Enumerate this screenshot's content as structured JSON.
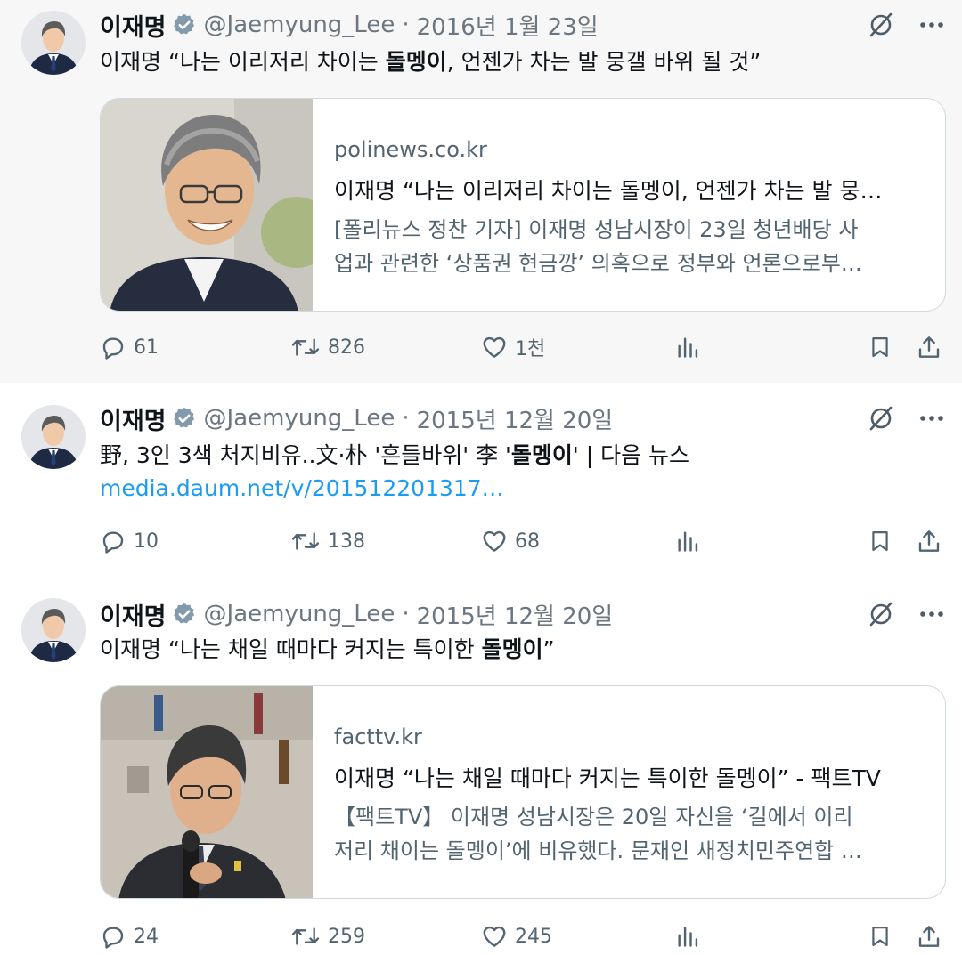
{
  "author": {
    "name": "이재명",
    "handle": "@Jaemyung_Lee",
    "verified_icon": "verified-badge-icon",
    "accent_color": "#1d9bf0"
  },
  "tweets": [
    {
      "separator": "·",
      "date": "2016년 1월 23일",
      "text_before": "이재명 “나는 이리저리 차이는 ",
      "text_bold": "돌멩이",
      "text_after": ", 언젠가 차는 발 뭉갤 바위 될 것”",
      "card": {
        "domain": "polinews.co.kr",
        "title": "이재명 “나는 이리저리 차이는 돌멩이, 언젠가 차는 발 뭉…",
        "desc_line1": "[폴리뉴스 정찬 기자] 이재명 성남시장이 23일 청년배당 사",
        "desc_line2": "업과 관련한 ‘상품권 현금깡’ 의혹으로 정부와 언론으로부…"
      },
      "stats": {
        "replies": "61",
        "retweets": "826",
        "likes": "1천"
      }
    },
    {
      "separator": "·",
      "date": "2015년 12월 20일",
      "text_before": "野, 3인 3색 처지비유..文·朴 '흔들바위' 李 '",
      "text_bold": "돌멩이",
      "text_after": "' | 다음 뉴스",
      "link": "media.daum.net/v/201512201317…",
      "stats": {
        "replies": "10",
        "retweets": "138",
        "likes": "68"
      }
    },
    {
      "separator": "·",
      "date": "2015년 12월 20일",
      "text_before": "이재명 “나는 채일 때마다 커지는 특이한 ",
      "text_bold": "돌멩이",
      "text_after": "”",
      "card": {
        "domain": "facttv.kr",
        "title": "이재명 “나는 채일 때마다 커지는 특이한 돌멩이” - 팩트TV",
        "desc_line1": "【팩트TV】 이재명 성남시장은 20일 자신을 ‘길에서 이리",
        "desc_line2": "저리 채이는 돌멩이’에 비유했다. 문재인 새정치민주연합 …"
      },
      "stats": {
        "replies": "24",
        "retweets": "259",
        "likes": "245"
      }
    }
  ]
}
